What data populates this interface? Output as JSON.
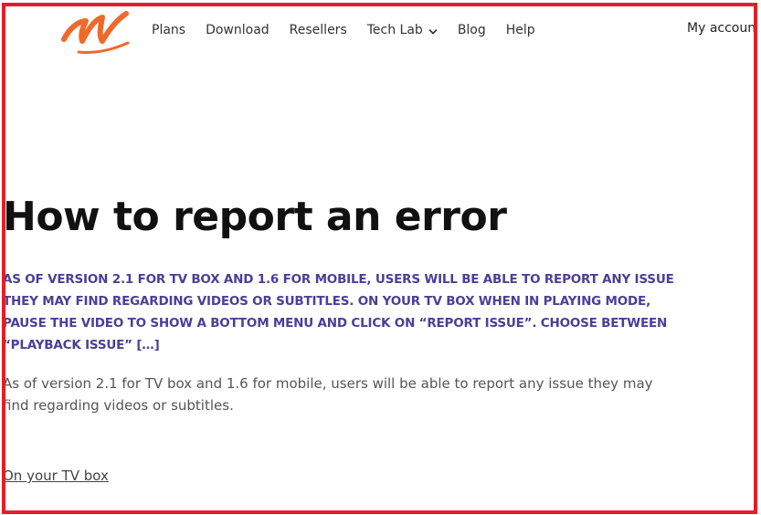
{
  "brand": {
    "logo_icon": "m-logo-icon",
    "accent_color": "#ee6a2c"
  },
  "nav": {
    "items": [
      {
        "label": "Plans"
      },
      {
        "label": "Download"
      },
      {
        "label": "Resellers"
      },
      {
        "label": "Tech Lab",
        "has_dropdown": true
      },
      {
        "label": "Blog"
      },
      {
        "label": "Help"
      }
    ],
    "account_label": "My account"
  },
  "article": {
    "title": "How to report an error",
    "excerpt": "AS OF VERSION 2.1 FOR TV BOX AND 1.6 FOR MOBILE, USERS WILL BE ABLE TO REPORT ANY ISSUE THEY MAY FIND REGARDING VIDEOS OR SUBTITLES.   ON YOUR TV BOX   WHEN IN PLAYING MODE, PAUSE THE VIDEO TO SHOW A BOTTOM MENU AND CLICK ON “REPORT ISSUE”.     CHOOSE BETWEEN “PLAYBACK ISSUE” […]",
    "body": "As of version 2.1 for TV box and 1.6 for mobile, users will be able to report any issue they may find regarding videos or subtitles.",
    "section_link": "On your TV box"
  },
  "colors": {
    "frame_border": "#e61e24",
    "excerpt": "#4a3f99"
  }
}
